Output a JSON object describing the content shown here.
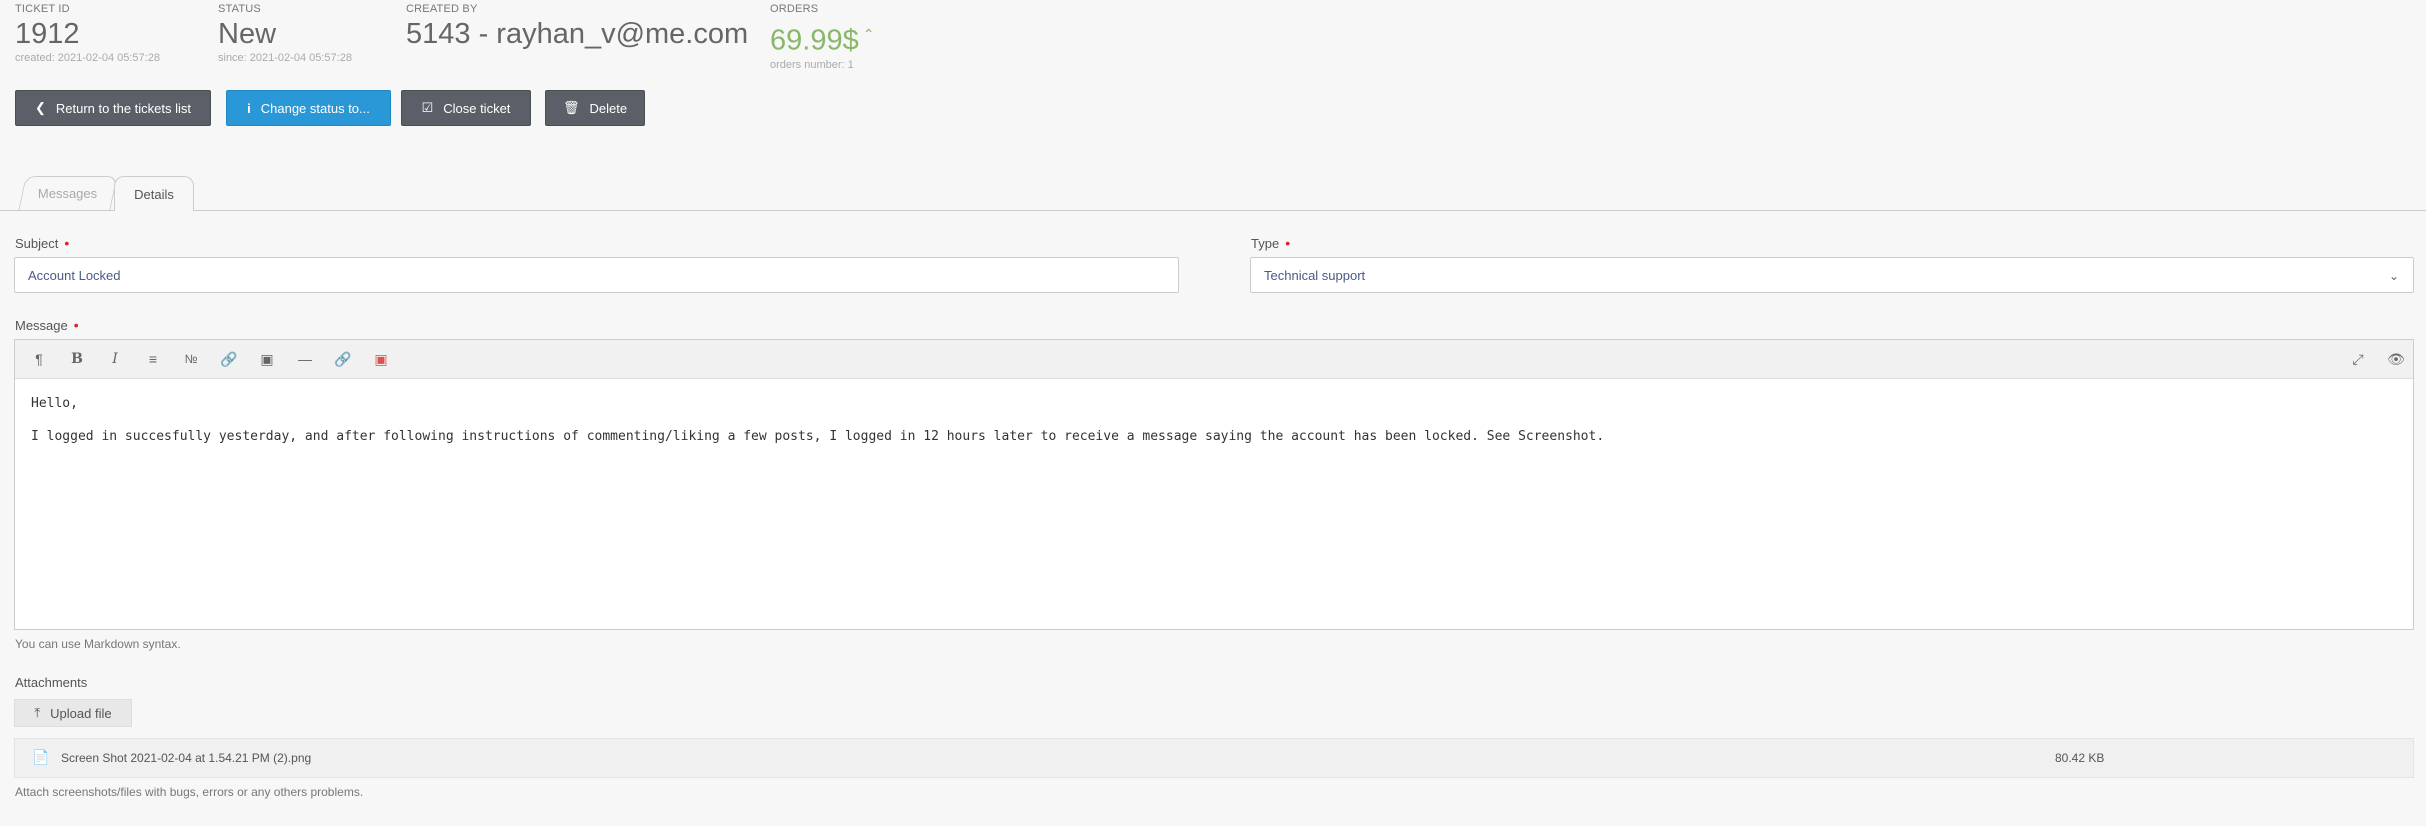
{
  "info": {
    "ticket_id": {
      "label": "TICKET ID",
      "value": "1912",
      "sub": "created: 2021-02-04 05:57:28"
    },
    "status": {
      "label": "STATUS",
      "value": "New",
      "sub": "since: 2021-02-04 05:57:28"
    },
    "created_by": {
      "label": "CREATED BY",
      "value": "5143 - rayhan_v@me.com"
    },
    "orders": {
      "label": "ORDERS",
      "value": "69.99$",
      "sub": "orders number: 1"
    }
  },
  "buttons": {
    "return_label": "Return to the tickets list",
    "change_status_label": "Change status to...",
    "close_label": "Close ticket",
    "delete_label": "Delete"
  },
  "tabs": [
    {
      "label": "Messages",
      "active": false
    },
    {
      "label": "Details",
      "active": true
    }
  ],
  "form": {
    "subject": {
      "label": "Subject",
      "value": "Account Locked"
    },
    "type": {
      "label": "Type",
      "value": "Technical support"
    },
    "message": {
      "label": "Message",
      "lines": [
        "Hello,",
        "I logged in succesfully yesterday, and after following instructions of commenting/liking a few posts, I logged in 12 hours later to receive a message saying the account has been locked. See Screenshot."
      ],
      "hint": "You can use Markdown syntax."
    },
    "attachments": {
      "label": "Attachments",
      "upload_label": "Upload file",
      "files": [
        {
          "name": "Screen Shot 2021-02-04 at 1.54.21 PM (2).png",
          "size": "80.42 KB"
        }
      ],
      "hint": "Attach screenshots/files with bugs, errors or any others problems."
    }
  },
  "toolbar_icons": [
    "paragraph-icon",
    "bold-icon",
    "italic-icon",
    "unordered-list-icon",
    "ordered-list-icon",
    "link-icon",
    "image-icon",
    "horizontal-rule-icon",
    "unlink-icon",
    "insert-image-icon",
    "fullscreen-icon",
    "preview-icon"
  ],
  "colors": {
    "accent_blue": "#2a97d6",
    "dark_button": "#5b6068",
    "orders_green": "#8ab86a",
    "required_red": "#dd2222"
  }
}
